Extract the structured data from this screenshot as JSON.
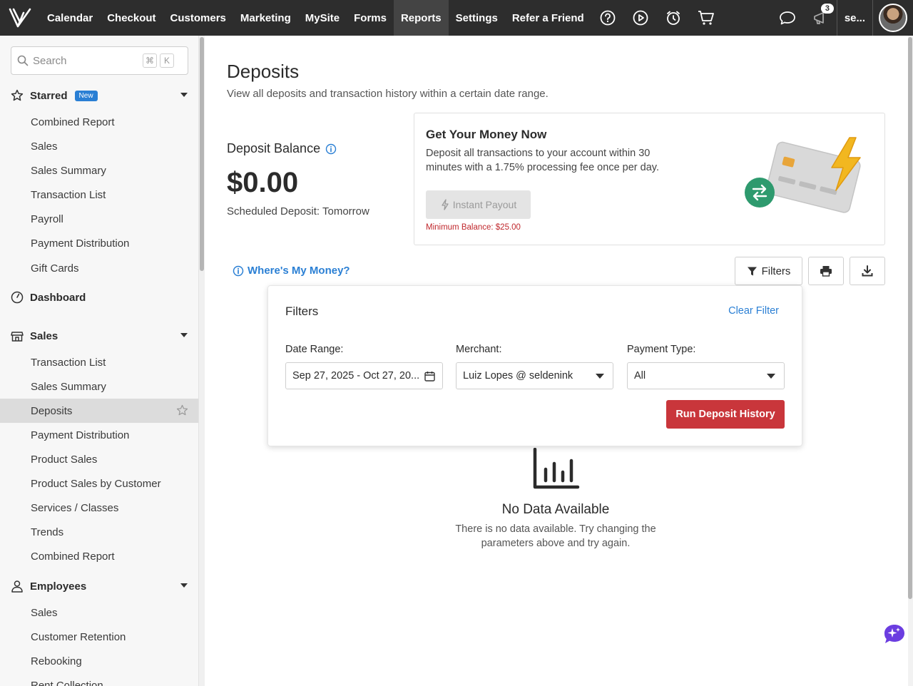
{
  "topbar": {
    "nav": [
      {
        "label": "Calendar",
        "active": false
      },
      {
        "label": "Checkout",
        "active": false
      },
      {
        "label": "Customers",
        "active": false
      },
      {
        "label": "Marketing",
        "active": false
      },
      {
        "label": "MySite",
        "active": false
      },
      {
        "label": "Forms",
        "active": false
      },
      {
        "label": "Reports",
        "active": true
      },
      {
        "label": "Settings",
        "active": false
      },
      {
        "label": "Refer a Friend",
        "active": false
      }
    ],
    "notification_count": "3",
    "user_short": "se..."
  },
  "sidebar": {
    "search_placeholder": "Search",
    "shortcut_keys": [
      "⌘",
      "K"
    ],
    "starred": {
      "label": "Starred",
      "badge": "New",
      "items": [
        "Combined Report",
        "Sales",
        "Sales Summary",
        "Transaction List",
        "Payroll",
        "Payment Distribution",
        "Gift Cards"
      ]
    },
    "dashboard": {
      "label": "Dashboard"
    },
    "sales": {
      "label": "Sales",
      "items": [
        "Transaction List",
        "Sales Summary",
        "Deposits",
        "Payment Distribution",
        "Product Sales",
        "Product Sales by Customer",
        "Services / Classes",
        "Trends",
        "Combined Report"
      ],
      "active_item": "Deposits"
    },
    "employees": {
      "label": "Employees",
      "items": [
        "Sales",
        "Customer Retention",
        "Rebooking",
        "Rent Collection"
      ]
    }
  },
  "main": {
    "title": "Deposits",
    "subtitle": "View all deposits and transaction history within a certain date range.",
    "balance_label": "Deposit Balance",
    "balance_amount": "$0.00",
    "scheduled": "Scheduled Deposit: Tomorrow",
    "promo": {
      "title": "Get Your Money Now",
      "description": "Deposit all transactions to your account within 30 minutes with a 1.75% processing fee once per day.",
      "button": "Instant Payout",
      "min_balance": "Minimum Balance: $25.00"
    },
    "where_link": "Where's My Money?",
    "filters_button": "Filters",
    "filters_panel": {
      "title": "Filters",
      "clear": "Clear Filter",
      "date_label": "Date Range:",
      "date_value": "Sep 27, 2025 - Oct 27, 20...",
      "merchant_label": "Merchant:",
      "merchant_value": "Luiz Lopes @ seldenink",
      "payment_label": "Payment Type:",
      "payment_value": "All",
      "run_button": "Run Deposit History"
    },
    "empty": {
      "title": "No Data Available",
      "description": "There is no data available. Try changing the parameters above and try again."
    }
  },
  "colors": {
    "topbar": "#2d2d2d",
    "accent_blue": "#2a7fd4",
    "run_red": "#c9363b",
    "error_red": "#c0282d"
  }
}
